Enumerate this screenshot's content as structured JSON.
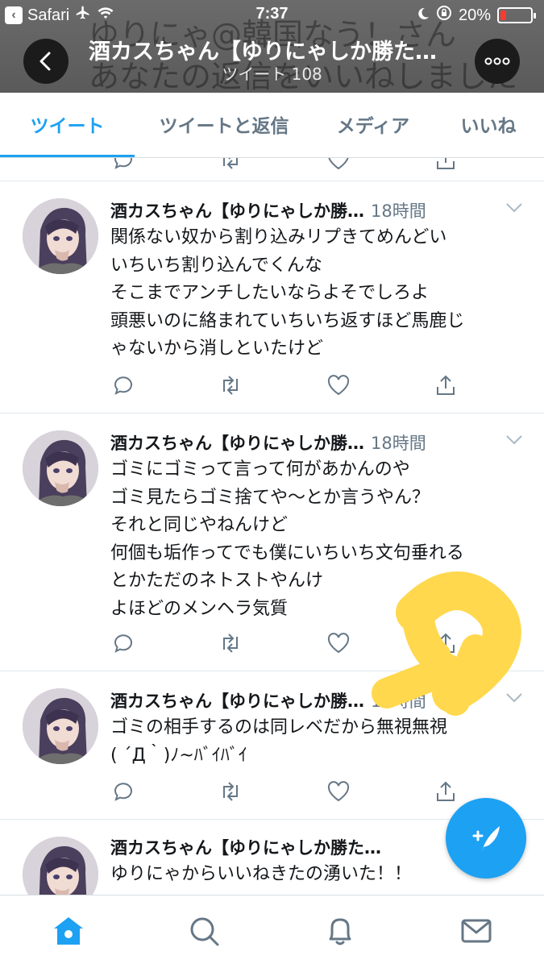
{
  "status_bar": {
    "app": "Safari",
    "time": "7:37",
    "battery": "20%"
  },
  "header": {
    "title": "酒カスちゃん【ゆりにゃしか勝た…",
    "subtitle": "ツイート 108",
    "banner_line1": "ゆりにゃ@韓国なう！さん",
    "banner_line2": "あなたの返信をいいねしました"
  },
  "tabs": [
    {
      "label": "ツイート",
      "active": true
    },
    {
      "label": "ツイートと返信",
      "active": false
    },
    {
      "label": "メディア",
      "active": false
    },
    {
      "label": "いいね",
      "active": false
    }
  ],
  "tweets": [
    {
      "name": "酒カスちゃん【ゆりにゃしか勝…",
      "time": "18時間",
      "lines": [
        "関係ない奴から割り込みリプきてめんどい",
        "いちいち割り込んでくんな",
        "そこまでアンチしたいならよそでしろよ",
        "頭悪いのに絡まれていちいち返すほど馬鹿じ",
        "ゃないから消しといたけど"
      ]
    },
    {
      "name": "酒カスちゃん【ゆりにゃしか勝…",
      "time": "18時間",
      "lines": [
        "ゴミにゴミって言って何があかんのや",
        "ゴミ見たらゴミ捨てや〜とか言うやん？",
        "それと同じやねんけど",
        "何個も垢作ってでも僕にいちいち文句垂れる",
        "とかただのネトストやんけ",
        "よほどのメンヘラ気質"
      ]
    },
    {
      "name": "酒カスちゃん【ゆりにゃしか勝…",
      "time": "18時間",
      "lines": [
        "ゴミの相手するのは同レベだから無視無視",
        "( ´Д｀)ﾉ~ﾊﾞｲﾊﾞｲ"
      ]
    },
    {
      "name": "酒カスちゃん【ゆりにゃしか勝た…",
      "time": "",
      "lines": [
        "ゆりにゃからいいねきたの湧いた！！"
      ]
    }
  ],
  "colors": {
    "accent": "#1da1f2",
    "secondary_text": "#657786",
    "highlighter": "#ffd84d"
  },
  "icons": {
    "back": "chevron-left-icon",
    "more": "more-icon",
    "reply": "reply-icon",
    "retweet": "retweet-icon",
    "like": "heart-icon",
    "share": "share-icon",
    "compose": "compose-icon",
    "home": "home-icon",
    "search": "search-icon",
    "notifications": "bell-icon",
    "messages": "mail-icon"
  }
}
